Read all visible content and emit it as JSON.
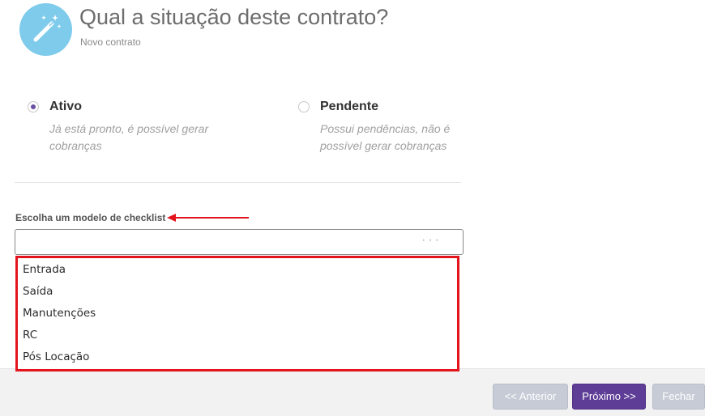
{
  "header": {
    "title": "Qual a situação deste contrato?",
    "subtitle": "Novo contrato",
    "icon": "magic-wand-icon",
    "icon_bg_color": "#7ecbec"
  },
  "status_options": [
    {
      "label": "Ativo",
      "description": "Já está pronto, é possível gerar cobranças",
      "selected": true
    },
    {
      "label": "Pendente",
      "description": "Possui pendências, não é possível gerar cobranças",
      "selected": false
    }
  ],
  "checklist": {
    "label": "Escolha um modelo de checklist",
    "value": "",
    "more_glyph": "···",
    "options": [
      "Entrada",
      "Saída",
      "Manutenções",
      "RC",
      "Pós Locação"
    ]
  },
  "footer": {
    "prev_label": "<< Anterior",
    "next_label": "Próximo >>",
    "close_label": "Fechar"
  },
  "colors": {
    "accent": "#5e3d96",
    "annotation": "#e3141b",
    "disabled_button": "#c6cbd6"
  }
}
